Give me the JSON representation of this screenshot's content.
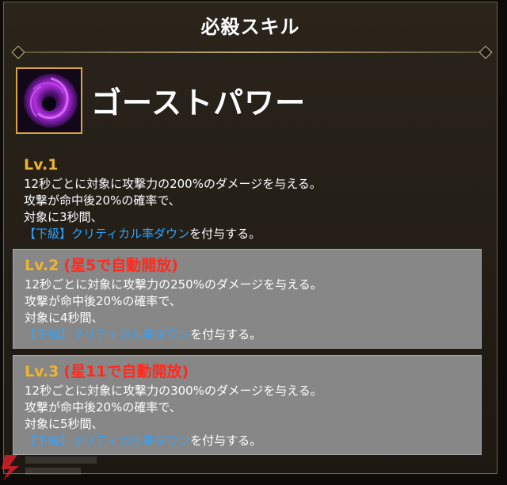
{
  "header": {
    "title": "必殺スキル"
  },
  "skill": {
    "name": "ゴーストパワー",
    "icon": "purple-vortex-icon"
  },
  "levels": [
    {
      "label": "Lv.1",
      "unlock": "",
      "lines": [
        "12秒ごとに対象に攻撃力の200%のダメージを与える。",
        "攻撃が命中後20%の確率で、",
        "対象に3秒間、"
      ],
      "effect": "【下級】クリティカル率ダウン",
      "effect_suffix": "を付与する。"
    },
    {
      "label": "Lv.2",
      "unlock": "(星5で自動開放)",
      "lines": [
        "12秒ごとに対象に攻撃力の250%のダメージを与える。",
        "攻撃が命中後20%の確率で、",
        "対象に4秒間、"
      ],
      "effect": "【下級】クリティカル率ダウン",
      "effect_suffix": "を付与する。"
    },
    {
      "label": "Lv.3",
      "unlock": "(星11で自動開放)",
      "lines": [
        "12秒ごとに対象に攻撃力の300%のダメージを与える。",
        "攻撃が命中後20%の確率で、",
        "対象に5秒間、"
      ],
      "effect": "【下級】クリティカル率ダウン",
      "effect_suffix": "を付与する。"
    }
  ],
  "colors": {
    "level_label": "#f0b42c",
    "unlock_text": "#ff2a1e",
    "effect_text": "#2fa4ff",
    "icon_border": "#d9a441"
  }
}
